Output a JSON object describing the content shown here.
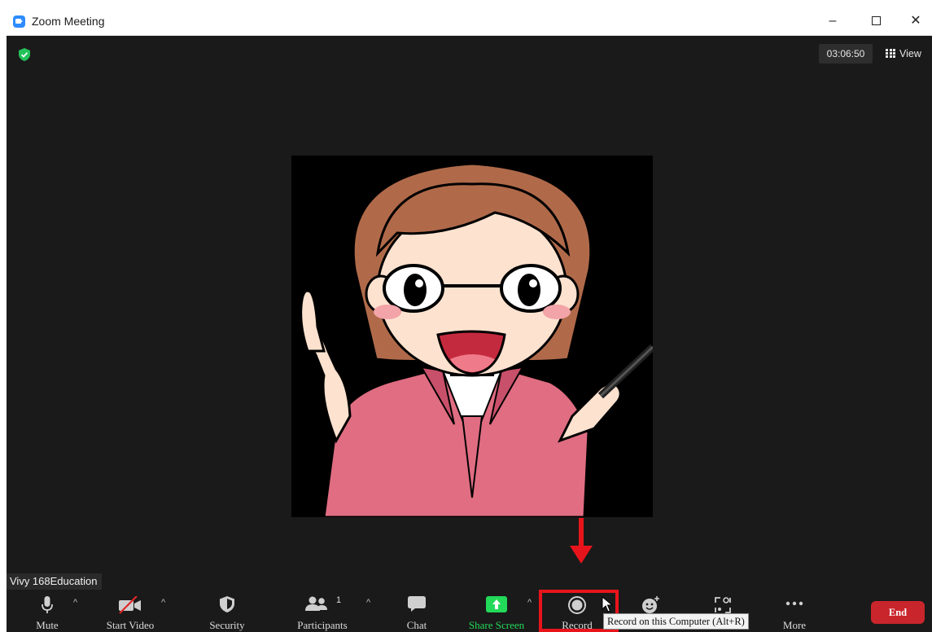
{
  "window": {
    "title": "Zoom Meeting",
    "icon": "zoom-app-icon"
  },
  "window_controls": {
    "minimize": "–",
    "close": "✕"
  },
  "meeting": {
    "security_indicator": "green-shield-check-icon",
    "timer": "03:06:50",
    "view_label": "View",
    "participant_name": "Vivy 168Education",
    "participant_count": "1"
  },
  "toolbar": {
    "mute": "Mute",
    "start_video": "Start Video",
    "security": "Security",
    "participants": "Participants",
    "chat": "Chat",
    "share_screen": "Share Screen",
    "record": "Record",
    "reactions": "Reactions",
    "apps": "Apps",
    "more": "More",
    "end": "End",
    "caret": "^"
  },
  "tooltip": {
    "text": "Record on this Computer (Alt+R)"
  },
  "colors": {
    "meeting_bg": "#1a1a1a",
    "share_green": "#23d959",
    "end_red": "#c9252c",
    "highlight_red": "#e8141b",
    "zoom_blue": "#2d8cff"
  }
}
